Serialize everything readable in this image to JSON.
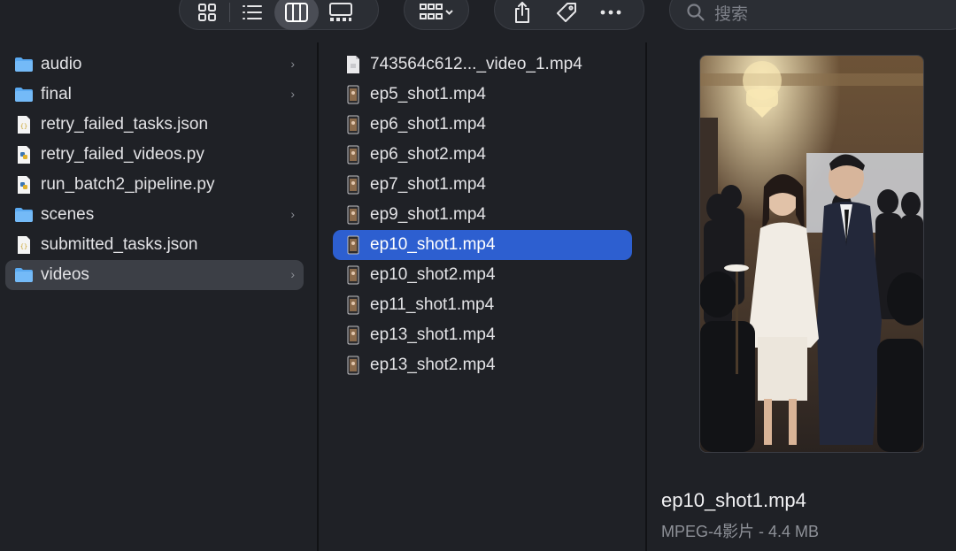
{
  "toolbar": {
    "view_buttons": [
      "icon-view-icon",
      "list-view-icon",
      "column-view-icon",
      "gallery-view-icon"
    ],
    "active_view": "column-view-icon",
    "search_placeholder": "搜索"
  },
  "sidebar_column": {
    "items": [
      {
        "label": "audio",
        "type": "folder",
        "has_children": true
      },
      {
        "label": "final",
        "type": "folder",
        "has_children": true
      },
      {
        "label": "retry_failed_tasks.json",
        "type": "json"
      },
      {
        "label": "retry_failed_videos.py",
        "type": "python"
      },
      {
        "label": "run_batch2_pipeline.py",
        "type": "python"
      },
      {
        "label": "scenes",
        "type": "folder",
        "has_children": true
      },
      {
        "label": "submitted_tasks.json",
        "type": "json"
      },
      {
        "label": "videos",
        "type": "folder",
        "has_children": true,
        "selected": true
      }
    ]
  },
  "files_column": {
    "items": [
      {
        "label": "743564c612..._video_1.mp4",
        "type": "doc"
      },
      {
        "label": "ep5_shot1.mp4",
        "type": "video"
      },
      {
        "label": "ep6_shot1.mp4",
        "type": "video"
      },
      {
        "label": "ep6_shot2.mp4",
        "type": "video"
      },
      {
        "label": "ep7_shot1.mp4",
        "type": "video"
      },
      {
        "label": "ep9_shot1.mp4",
        "type": "video"
      },
      {
        "label": "ep10_shot1.mp4",
        "type": "video",
        "selected": true
      },
      {
        "label": "ep10_shot2.mp4",
        "type": "video"
      },
      {
        "label": "ep11_shot1.mp4",
        "type": "video"
      },
      {
        "label": "ep13_shot1.mp4",
        "type": "video"
      },
      {
        "label": "ep13_shot2.mp4",
        "type": "video"
      }
    ]
  },
  "preview": {
    "filename": "ep10_shot1.mp4",
    "meta": "MPEG-4影片 - 4.4 MB"
  },
  "colors": {
    "background": "#1f2126",
    "selection_active": "#2d5fd0",
    "selection_inactive": "#3c3f46",
    "folder": "#5aa9f0"
  }
}
